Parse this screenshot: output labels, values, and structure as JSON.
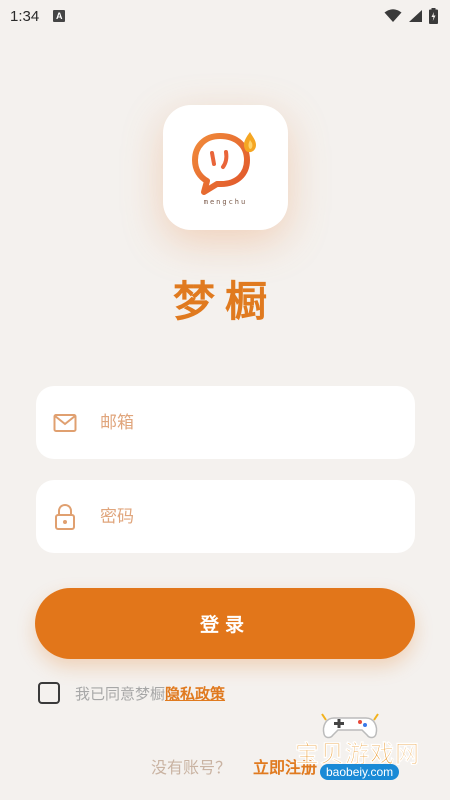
{
  "status_bar": {
    "time": "1:34",
    "app_icon_letter": "A",
    "icons": [
      "wifi-icon",
      "signal-icon",
      "battery-icon"
    ]
  },
  "logo": {
    "wordmark": "mengchu"
  },
  "app": {
    "title": "梦橱"
  },
  "form": {
    "email_placeholder": "邮箱",
    "password_placeholder": "密码",
    "login_label": "登录"
  },
  "agreement": {
    "text": "我已同意梦橱",
    "link": "隐私政策",
    "checked": false
  },
  "register": {
    "prompt": "没有账号？",
    "link": "立即注册"
  },
  "watermark": {
    "title": "宝贝游戏网",
    "url": "baobeiy.com"
  },
  "colors": {
    "accent": "#e2761a",
    "background": "#f4f1ee",
    "placeholder": "#e0a57c"
  }
}
